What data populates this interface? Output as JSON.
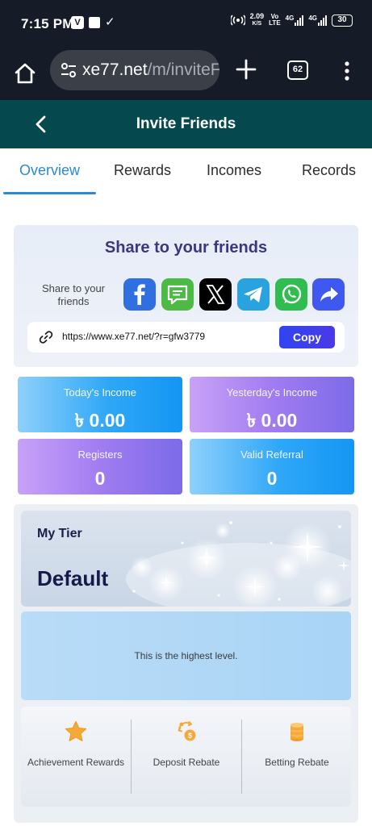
{
  "status_bar": {
    "time": "7:15 PM",
    "speed_value": "2.09",
    "speed_unit": "K/S",
    "volte_top": "Vo",
    "volte_bottom": "LTE",
    "net_1": "4G",
    "net_2": "4G",
    "battery": "30"
  },
  "browser": {
    "url_main": "xe77.net",
    "url_path": "/m/inviteF",
    "tab_count": "62"
  },
  "header": {
    "title": "Invite Friends"
  },
  "tabs": [
    {
      "label": "Overview",
      "active": true
    },
    {
      "label": "Rewards",
      "active": false
    },
    {
      "label": "Incomes",
      "active": false
    },
    {
      "label": "Records",
      "active": false
    }
  ],
  "share": {
    "title": "Share to your friends",
    "label": "Share to your friends",
    "channels": [
      "facebook",
      "message",
      "x",
      "telegram",
      "whatsapp",
      "share"
    ],
    "link": "https://www.xe77.net/?r=gfw3779",
    "copy_label": "Copy"
  },
  "stats": {
    "today_income": {
      "label": "Today's Income",
      "value": "৳ 0.00"
    },
    "yesterday_income": {
      "label": "Yesterday's Income",
      "value": "৳ 0.00"
    },
    "registers": {
      "label": "Registers",
      "value": "0"
    },
    "valid_referral": {
      "label": "Valid Referral",
      "value": "0"
    }
  },
  "tier": {
    "heading": "My Tier",
    "name": "Default",
    "info": "This is the highest level.",
    "items": [
      {
        "label": "Achievement Rewards",
        "icon": "star-icon"
      },
      {
        "label": "Deposit Rebate",
        "icon": "deposit-rebate-icon"
      },
      {
        "label": "Betting Rebate",
        "icon": "coin-stack-icon"
      }
    ]
  },
  "colors": {
    "status_bg": "#151b27",
    "header_bg": "#05484d",
    "accent_blue": "#2a8ad6",
    "title_purple": "#3e3580",
    "copy_button": "#2f45f0"
  }
}
